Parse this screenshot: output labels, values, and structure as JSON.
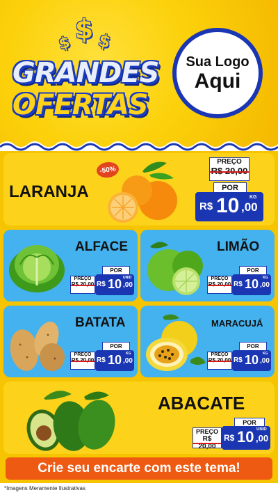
{
  "header": {
    "dollar_signs": [
      "$",
      "$",
      "$"
    ],
    "title_line1": "GRANDES",
    "title_line2": "OFERTAS",
    "logo_line1": "Sua Logo",
    "logo_line2": "Aqui"
  },
  "discount_badge": "-50%",
  "products": {
    "laranja": {
      "name": "LARANJA",
      "preco_label": "PREÇO",
      "old_price": "R$ 20,00",
      "por_label": "POR",
      "currency": "R$",
      "price_int": "10",
      "price_dec": ",00",
      "unit": "KG"
    },
    "alface": {
      "name": "ALFACE",
      "preco_label": "PREÇO",
      "old_price": "R$ 20,00",
      "por_label": "POR",
      "currency": "R$",
      "price_int": "10",
      "price_dec": ",00",
      "unit": "UNID"
    },
    "limao": {
      "name": "LIMÃO",
      "preco_label": "PREÇO",
      "old_price": "R$ 20,00",
      "por_label": "POR",
      "currency": "R$",
      "price_int": "10",
      "price_dec": ",00",
      "unit": "KG"
    },
    "batata": {
      "name": "BATATA",
      "preco_label": "PREÇO",
      "old_price": "R$ 20,00",
      "por_label": "POR",
      "currency": "R$",
      "price_int": "10",
      "price_dec": ",00",
      "unit": "KG"
    },
    "maracuja": {
      "name": "MARACUJÁ",
      "preco_label": "PREÇO",
      "old_price": "R$ 20,00",
      "por_label": "POR",
      "currency": "R$",
      "price_int": "10",
      "price_dec": ",00",
      "unit": "KG"
    },
    "abacate": {
      "name": "ABACATE",
      "preco_label": "PREÇO",
      "old_price": "R$ 20,00",
      "por_label": "POR",
      "currency": "R$",
      "price_int": "10",
      "price_dec": ",00",
      "unit": "UNID"
    }
  },
  "cta": "Crie seu encarte com este tema!",
  "footnote": "*Imagens Meramente Ilustrativas",
  "colors": {
    "yellow": "#fdd21b",
    "blue": "#43b2ee",
    "navy": "#1b36b3",
    "orange": "#ee5a12",
    "red": "#d41a1a"
  }
}
